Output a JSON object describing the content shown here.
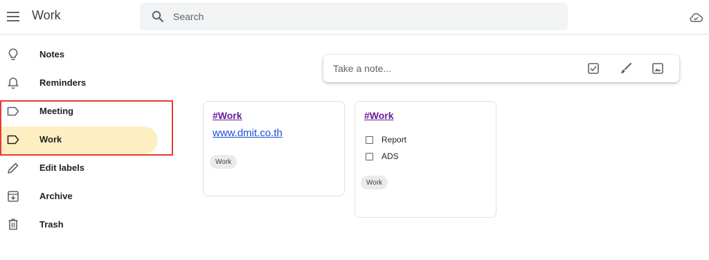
{
  "header": {
    "app_title": "Work",
    "search_placeholder": "Search",
    "icons": {
      "menu": "menu-icon",
      "search": "search-icon",
      "cloud": "cloud-sync-icon"
    }
  },
  "sidebar": {
    "items": [
      {
        "label": "Notes",
        "icon": "lightbulb-icon",
        "active": false
      },
      {
        "label": "Reminders",
        "icon": "bell-icon",
        "active": false
      },
      {
        "label": "Meeting",
        "icon": "label-icon",
        "active": false
      },
      {
        "label": "Work",
        "icon": "label-icon",
        "active": true
      },
      {
        "label": "Edit labels",
        "icon": "pencil-icon",
        "active": false
      },
      {
        "label": "Archive",
        "icon": "archive-icon",
        "active": false
      },
      {
        "label": "Trash",
        "icon": "trash-icon",
        "active": false
      }
    ],
    "active_color": "#feefc3",
    "highlight_color": "#e53935"
  },
  "take_note": {
    "placeholder": "Take a note...",
    "icons": [
      "checkbox-icon",
      "brush-icon",
      "image-icon"
    ]
  },
  "notes": [
    {
      "title": "#Work",
      "link": "www.dmit.co.th",
      "label": "Work"
    },
    {
      "title": "#Work",
      "items": [
        {
          "text": "Report",
          "checked": false
        },
        {
          "text": "ADS",
          "checked": false
        }
      ],
      "label": "Work"
    }
  ]
}
